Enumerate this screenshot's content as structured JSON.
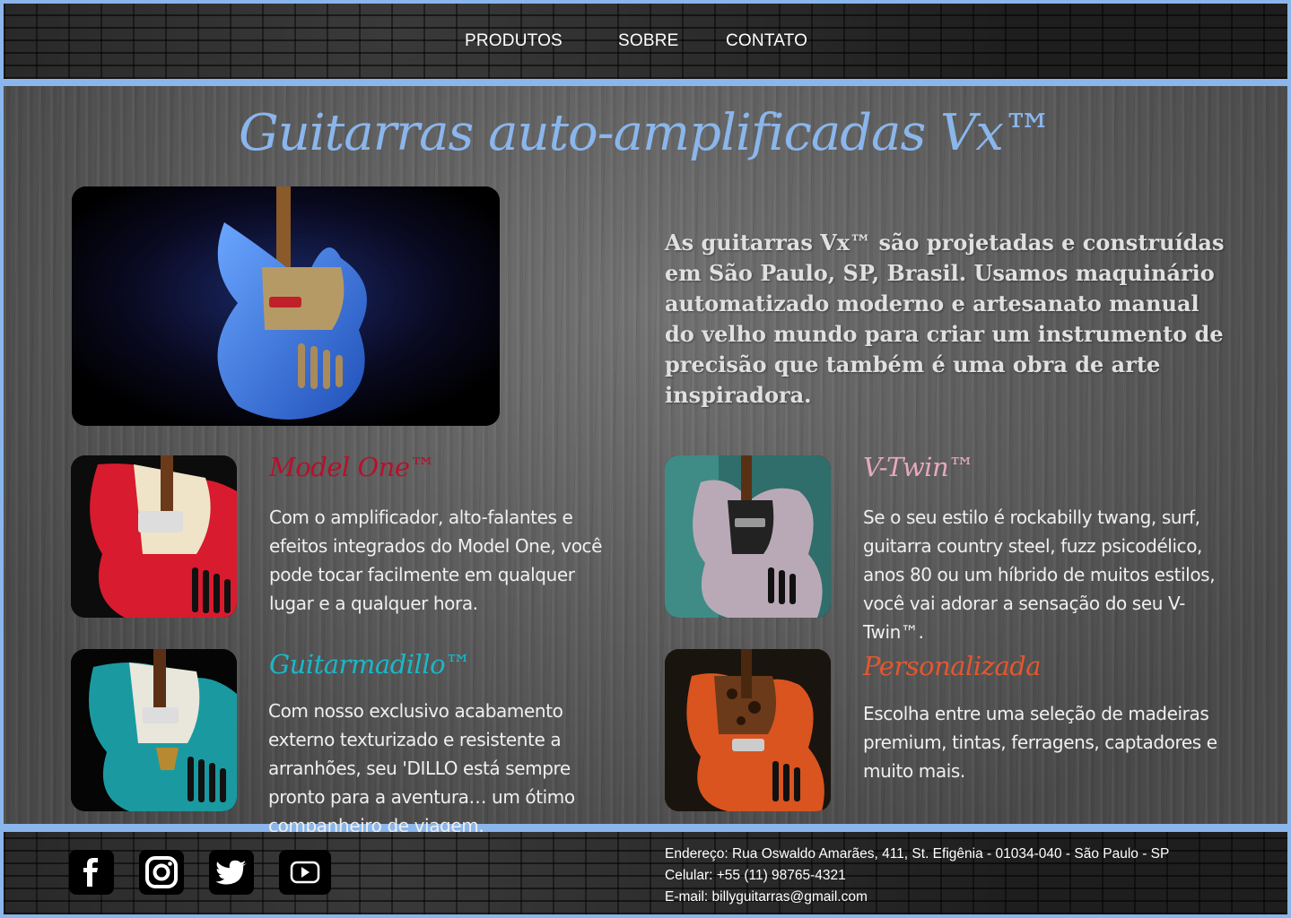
{
  "nav": {
    "items": [
      {
        "label": "PRODUTOS"
      },
      {
        "label": "SOBRE"
      },
      {
        "label": "CONTATO"
      }
    ]
  },
  "main": {
    "title": "Guitarras auto-amplificadas Vx™",
    "intro": "As guitarras Vx™ são projetadas e construídas em São Paulo, SP, Brasil. Usamos maquinário automatizado moderno e artesanato manual do velho mundo para criar um instrumento de precisão que também é uma obra de arte inspiradora."
  },
  "products": [
    {
      "title": "Model One™",
      "color": "#b8102a",
      "body_color": "#d81b2e",
      "description": "Com o amplificador, alto-falantes e efeitos integrados do Model One, você pode tocar facilmente em qualquer lugar e a qualquer hora."
    },
    {
      "title": "V-Twin™",
      "color": "#e8a8c0",
      "body_color": "#b9a9b6",
      "description": "Se o seu estilo é rockabilly twang, surf, guitarra country steel, fuzz psicodélico, anos 80 ou um híbrido de muitos estilos, você vai adorar a sensação do seu V-Twin™."
    },
    {
      "title": "Guitarmadillo™",
      "color": "#19b8c8",
      "body_color": "#1a9aa0",
      "description": "Com nosso exclusivo acabamento externo texturizado e resistente a arranhões, seu 'DILLO está sempre pronto para a aventura… um ótimo companheiro de viagem."
    },
    {
      "title": "Personalizada",
      "color": "#e4572e",
      "body_color": "#d9541f",
      "description": "Escolha entre uma seleção de madeiras premium, tintas, ferragens, captadores e muito mais."
    }
  ],
  "footer": {
    "social": [
      {
        "icon": "facebook-icon"
      },
      {
        "icon": "instagram-icon"
      },
      {
        "icon": "twitter-icon"
      },
      {
        "icon": "youtube-icon"
      }
    ],
    "address": "Endereço: Rua Oswaldo Amarães, 411, St. Efigênia - 01034-040 - São Paulo - SP",
    "phone": "Celular: +55 (11) 98765-4321",
    "email": "E-mail: billyguitarras@gmail.com"
  },
  "colors": {
    "accent": "#8ab6ec",
    "page_border": "#8ab6ec"
  }
}
